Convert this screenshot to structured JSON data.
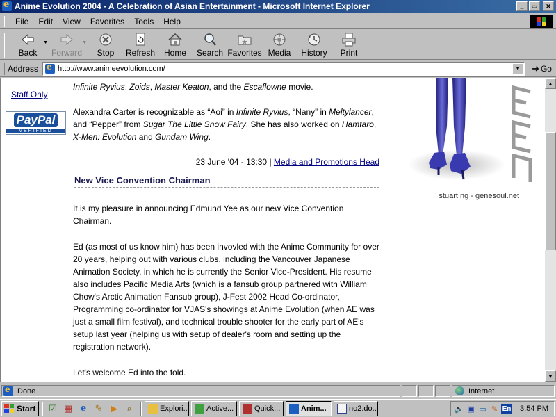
{
  "window": {
    "title": "Anime Evolution 2004 - A Celebration of Asian Entertainment - Microsoft Internet Explorer",
    "minimize": "_",
    "maximize": "▭",
    "close": "✕"
  },
  "menu": {
    "items": [
      "File",
      "Edit",
      "View",
      "Favorites",
      "Tools",
      "Help"
    ]
  },
  "toolbar": {
    "back": "Back",
    "forward": "Forward",
    "stop": "Stop",
    "refresh": "Refresh",
    "home": "Home",
    "search": "Search",
    "favorites": "Favorites",
    "media": "Media",
    "history": "History",
    "print": "Print"
  },
  "address": {
    "label": "Address",
    "url": "http://www.animeevolution.com/",
    "go": "Go"
  },
  "sidebar": {
    "staff_only": "Staff Only",
    "paypal_word": "PayPal",
    "paypal_verified": "VERIFIED"
  },
  "article": {
    "p1": {
      "s1": "Infinite Ryvius",
      "s2": ", ",
      "s3": "Zoids",
      "s4": ", ",
      "s5": "Master Keaton",
      "s6": ", and the ",
      "s7": "Escaflowne",
      "s8": " movie."
    },
    "p2": {
      "s1": "Alexandra Carter is recognizable as “Aoi” in ",
      "s2": "Infinite Ryvius",
      "s3": ", “Nany” in ",
      "s4": "Meltylancer",
      "s5": ", and “Pepper” from ",
      "s6": "Sugar The Little Snow Fairy",
      "s7": ".  She has also worked on ",
      "s8": "Hamtaro",
      "s9": ", ",
      "s10": "X-Men: Evolution",
      "s11": " and ",
      "s12": "Gundam Wing",
      "s13": "."
    },
    "news_meta": {
      "date": "23 June '04 - 13:30",
      "separator": " | ",
      "author_link": "Media and Promotions Head"
    },
    "news_title": "New Vice Convention Chairman",
    "p3": "It is my pleasure in announcing Edmund Yee as our new Vice Convention Chairman.",
    "p4": "Ed (as most of us know him) has been invovled with the Anime Community for over 20 years, helping out with various clubs, including the Vancouver Japanese Animation Society, in which he is currently the Senior Vice-President. His resume also includes Pacific Media Arts (which is a fansub group partnered with William Chow's Arctic Animation Fansub group), J-Fest 2002 Head Co-ordinator, Programming co-ordinator for VJAS's showings at Anime Evolution (when AE was just a small film festival), and technical trouble shooter for the early part of AE's setup last year (helping us with setup of dealer's room and setting up the registration network).",
    "p5": "Let's welcome Ed into the fold."
  },
  "artwork": {
    "caption": "stuart ng - genesoul.net"
  },
  "statusbar": {
    "status": "Done",
    "zone": "Internet"
  },
  "taskbar": {
    "start": "Start",
    "tasks": [
      "Explori...",
      "Active...",
      "Quick...",
      "Anim...",
      "no2.do..."
    ],
    "lang": "En",
    "clock": "3:54 PM"
  },
  "colors": {
    "titlebar_start": "#0a246a",
    "titlebar_end": "#3a6ea5",
    "link": "#000080",
    "chrome": "#c0c0c0"
  }
}
